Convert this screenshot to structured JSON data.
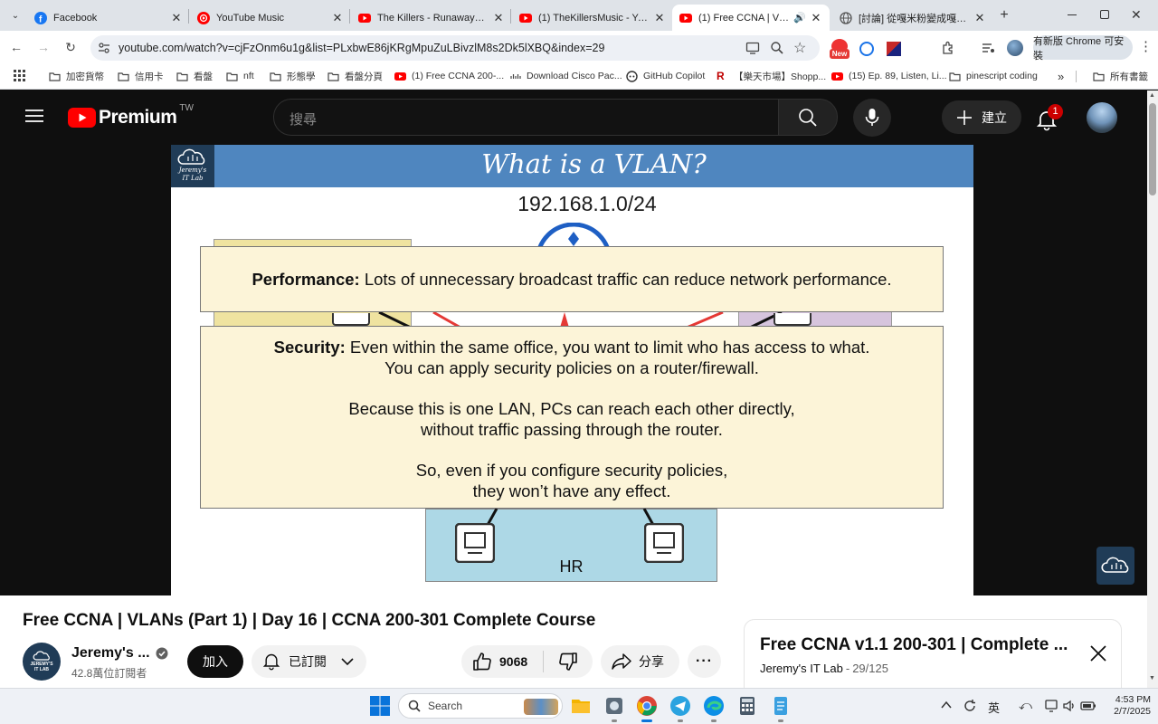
{
  "browser": {
    "tabs": [
      {
        "title": "Facebook"
      },
      {
        "title": "YouTube Music"
      },
      {
        "title": "The Killers - Runaways - Yo"
      },
      {
        "title": "(1) TheKillersMusic - YouTu"
      },
      {
        "title": "(1) Free CCNA | VLANs"
      },
      {
        "title": "[討論] 從嘎米粉變成嘎米黑"
      }
    ],
    "url": "youtube.com/watch?v=cjFzOnm6u1g&list=PLxbwE86jKRgMpuZuLBivzlM8s2Dk5lXBQ&index=29",
    "new_badge": "New",
    "update_button": "有新版 Chrome 可安裝",
    "bookmarks": [
      "加密貨幣",
      "信用卡",
      "看盤",
      "nft",
      "形態學",
      "看盤分頁",
      "(1) Free CCNA 200-...",
      "Download Cisco Pac...",
      "GitHub Copilot",
      "【樂天市場】Shopp...",
      "(15) Ep. 89, Listen, Li...",
      "pinescript coding"
    ],
    "more_bookmarks": "»",
    "all_bookmarks": "所有書籤"
  },
  "yt": {
    "logo_text": "Premium",
    "region": "TW",
    "search_placeholder": "搜尋",
    "create_label": "建立",
    "notif_count": "1"
  },
  "slide": {
    "title": "What is a VLAN?",
    "subnet": "192.168.1.0/24",
    "logo_line1": "Jeremy's",
    "logo_line2": "IT Lab",
    "performance_label": "Performance:",
    "performance_text": " Lots of unnecessary broadcast traffic can reduce network performance.",
    "security_label": "Security:",
    "security_line1": " Even within the same office, you want to limit who has access to what.",
    "security_line2": "You can apply security policies on a router/firewall.",
    "security_line3": "Because this is one LAN, PCs can reach each other directly,",
    "security_line4": "without traffic passing through the router.",
    "security_line5": "So, even if you configure security policies,",
    "security_line6": "they won’t have any effect.",
    "hr_label": "HR"
  },
  "video": {
    "title": "Free CCNA | VLANs (Part 1) | Day 16 | CCNA 200-301 Complete Course",
    "channel": "Jeremy's ...",
    "subscribers": "42.8萬位訂閱者",
    "join_label": "加入",
    "subscribed_label": "已訂閱",
    "like_count": "9068",
    "share_label": "分享",
    "avatar_line1": "JEREMY'S",
    "avatar_line2": "IT LAB"
  },
  "playlist": {
    "title": "Free CCNA v1.1 200-301 | Complete ...",
    "channel": "Jeremy's IT Lab",
    "position": "29/125"
  },
  "taskbar": {
    "search_label": "Search",
    "ime": "英",
    "time": "4:53 PM",
    "date": "2/7/2025"
  }
}
